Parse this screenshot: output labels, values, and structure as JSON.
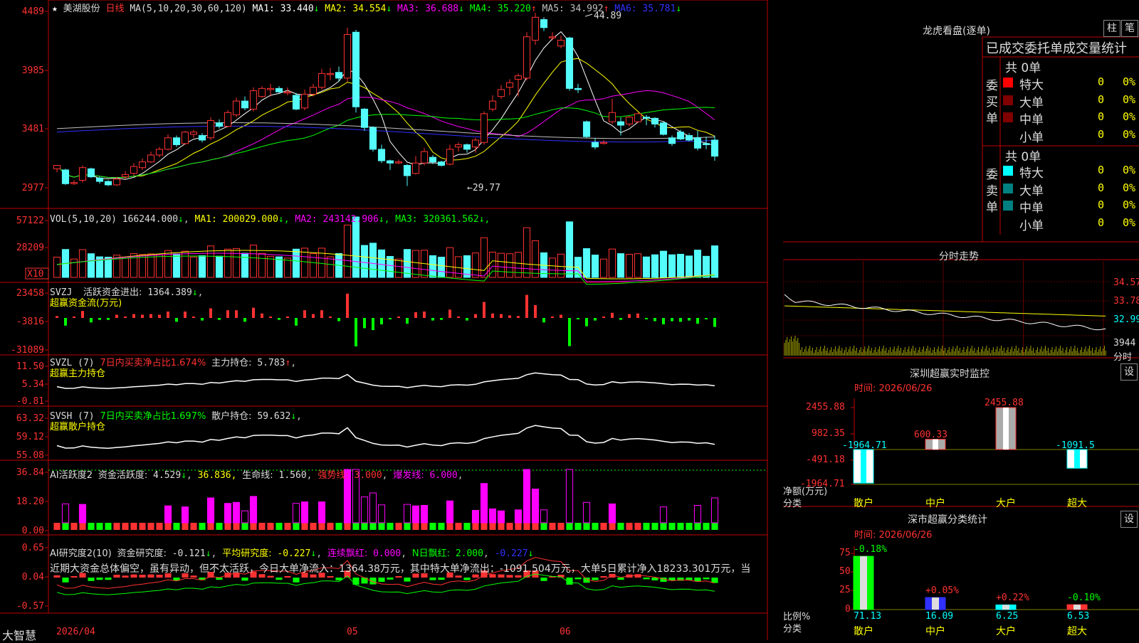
{
  "stock": {
    "name": "美湖股份",
    "period": "日线",
    "logo": "大智慧"
  },
  "colors": {
    "up": "#ff3232",
    "down": "#54fcfc",
    "cyan": "#00ffff",
    "yellow": "#ffff00",
    "magenta": "#ff00ff",
    "green": "#00ff00",
    "white": "#ffffff",
    "blue": "#3030ff",
    "grid": "#a00000",
    "axis": "#c00000"
  },
  "price_panel": {
    "ma_label": "MA(5,10,20,30,60,120)",
    "ma_items": [
      {
        "label": "MA1:",
        "value": "33.440",
        "arrow": "↓",
        "color": "#ffffff"
      },
      {
        "label": "MA2:",
        "value": "34.554",
        "arrow": "↓",
        "color": "#ffff00"
      },
      {
        "label": "MA3:",
        "value": "36.688",
        "arrow": "↓",
        "color": "#ff00ff"
      },
      {
        "label": "MA4:",
        "value": "35.220",
        "arrow": "↑",
        "color": "#00ff00"
      },
      {
        "label": "MA5:",
        "value": "34.992",
        "arrow": "↑",
        "color": "#c0c0c0"
      },
      {
        "label": "MA6:",
        "value": "35.781",
        "arrow": "↓",
        "color": "#3030ff"
      }
    ],
    "y_ticks": [
      "4489",
      "3985",
      "3481",
      "2977"
    ],
    "high_label": "44.89",
    "low_label": "29.77"
  },
  "vol_panel": {
    "title": "VOL(5,10,20)",
    "value": "166244.000",
    "arrow": "↓",
    "items": [
      {
        "label": "MA1:",
        "value": "200029.000",
        "arrow": "↓",
        "color": "#ffff00"
      },
      {
        "label": "MA2:",
        "value": "243142.906",
        "arrow": "↓",
        "color": "#ff00ff"
      },
      {
        "label": "MA3:",
        "value": "320361.562",
        "arrow": "↓",
        "color": "#00ff00"
      }
    ],
    "y_ticks": [
      "57122",
      "28209"
    ],
    "unit": "X10"
  },
  "svzj_panel": {
    "title": "SVZJ",
    "label": "活跃资金进出:",
    "value": "1364.389",
    "arrow": "↓",
    "subtitle": "超赢资金流(万元)",
    "y_ticks": [
      "23458",
      "-3816",
      "-31089"
    ]
  },
  "svzl_panel": {
    "title": "SVZL (7)",
    "pct_text": "7日内买卖净占比1.674%",
    "label": "主力持仓:",
    "value": "5.783",
    "arrow": "↑",
    "subtitle": "超赢主力持仓",
    "y_ticks": [
      "11.50",
      "5.34",
      "-0.81"
    ]
  },
  "svsh_panel": {
    "title": "SVSH (7)",
    "pct_text": "7日内买卖净占比1.697%",
    "label": "散户持仓:",
    "value": "59.632",
    "arrow": "↓",
    "subtitle": "超赢散户持仓",
    "y_ticks": [
      "63.32",
      "59.12",
      "55.08"
    ]
  },
  "ai_active": {
    "title": "AI活跃度2",
    "label": "资金活跃度:",
    "value": "4.529",
    "arrow": "↓",
    "v2": "36.836",
    "life_label": "生命线:",
    "life": "1.560",
    "strong_label": "强势线:",
    "strong": "3.000",
    "burst_label": "爆发线:",
    "burst": "6.000",
    "y_ticks": [
      "36.84",
      "18.20",
      "0.00"
    ]
  },
  "ai_research": {
    "title": "AI研究度2(10)",
    "label": "资金研究度:",
    "value": "-0.121",
    "arrow": "↓",
    "avg_label": "平均研究度:",
    "avg": "-0.227",
    "arrow2": "↓",
    "cont_label": "连续飘红:",
    "cont": "0.000",
    "n_label": "N日飘红:",
    "n": "2.000",
    "last": "-0.227",
    "arrow3": "↓",
    "commentary": "近期大资金总体偏空，虽有异动，但不太活跃，今日大单净流入：1364.38万元，其中特大单净流出：-1091.504万元，大单5日累计净入18233.301万元，当",
    "y_ticks": [
      "0.65",
      "0.04",
      "-0.57"
    ]
  },
  "x_axis": {
    "labels": [
      "2026/04",
      "05",
      "06"
    ]
  },
  "right": {
    "longhu_title": "龙虎看盘(逐单)",
    "btn1": "柱",
    "btn2": "笔",
    "stats_title": "已成交委托单成交量统计",
    "buy_label": "委买单",
    "sell_label": "委卖单",
    "buy_total": "共 0单",
    "sell_total": "共 0单",
    "buy_rows": [
      {
        "name": "特大",
        "count": "0",
        "pct": "0%",
        "color": "#ff0000"
      },
      {
        "name": "大单",
        "count": "0",
        "pct": "0%",
        "color": "#800000"
      },
      {
        "name": "中单",
        "count": "0",
        "pct": "0%",
        "color": "#800000"
      },
      {
        "name": "小单",
        "count": "0",
        "pct": "0%",
        "color": ""
      }
    ],
    "sell_rows": [
      {
        "name": "特大",
        "count": "0",
        "pct": "0%",
        "color": "#00ffff"
      },
      {
        "name": "大单",
        "count": "0",
        "pct": "0%",
        "color": "#008080"
      },
      {
        "name": "中单",
        "count": "0",
        "pct": "0%",
        "color": "#008080"
      },
      {
        "name": "小单",
        "count": "0",
        "pct": "0%",
        "color": ""
      }
    ],
    "intraday_title": "分时走势",
    "intraday_ticks": [
      "34.57",
      "33.78",
      "32.99"
    ],
    "intraday_vol": "3944",
    "intraday_vol_label": "分时",
    "monitor_title": "深圳超赢实时监控",
    "monitor_btn": "设",
    "monitor_date": "时间: 2026/06/26",
    "monitor_ticks": [
      "2455.88",
      "982.35",
      "-491.18",
      "-1964.71"
    ],
    "monitor_ylabel": "净额(万元)",
    "monitor_cat_label": "分类",
    "monitor_bars": [
      {
        "cat": "散户",
        "value": -1964.71,
        "label": "-1964.71",
        "color": "#00ffff"
      },
      {
        "cat": "中户",
        "value": 600.33,
        "label": "600.33",
        "color": "#ff3232"
      },
      {
        "cat": "大户",
        "value": 2455.88,
        "label": "2455.88",
        "color": "#ff3232"
      },
      {
        "cat": "超大",
        "value": -1091.5,
        "label": "-1091.5",
        "color": "#00ffff"
      }
    ],
    "class_title": "深市超赢分类统计",
    "class_btn": "设",
    "class_date": "时间: 2026/06/26",
    "class_ticks": [
      "75",
      "50",
      "25",
      "0"
    ],
    "class_ylabel": "比例%",
    "class_cat_label": "分类",
    "class_bars": [
      {
        "cat": "散户",
        "value": 71.13,
        "label": "71.13",
        "delta": "-0.18%",
        "color": "#00ff00",
        "cat_color": "#ffff00",
        "dcolor": "#00ff00"
      },
      {
        "cat": "中户",
        "value": 16.09,
        "label": "16.09",
        "delta": "+0.05%",
        "color": "#3030ff",
        "cat_color": "#ffff00",
        "dcolor": "#ff3232"
      },
      {
        "cat": "大户",
        "value": 6.25,
        "label": "6.25",
        "delta": "+0.22%",
        "color": "#00ffff",
        "cat_color": "#ffff00",
        "dcolor": "#ff3232"
      },
      {
        "cat": "超大",
        "value": 6.53,
        "label": "6.53",
        "delta": "-0.10%",
        "color": "#ff3232",
        "cat_color": "#ffff00",
        "dcolor": "#00ff00"
      }
    ]
  },
  "candles": [
    [
      31.3,
      31.6,
      31.0,
      31.5
    ],
    [
      31.2,
      30.0,
      29.9,
      31.3
    ],
    [
      30.1,
      30.1,
      29.9,
      30.3
    ],
    [
      30.3,
      31.4,
      30.1,
      31.6
    ],
    [
      31.3,
      30.6,
      30.5,
      31.4
    ],
    [
      30.5,
      30.2,
      30.0,
      30.6
    ],
    [
      30.2,
      29.9,
      29.8,
      30.3
    ],
    [
      29.9,
      30.4,
      29.8,
      30.6
    ],
    [
      30.6,
      30.8,
      30.4,
      31.1
    ],
    [
      30.9,
      31.5,
      30.7,
      31.8
    ],
    [
      31.4,
      31.9,
      31.2,
      32.2
    ],
    [
      31.9,
      32.5,
      31.8,
      32.8
    ],
    [
      32.5,
      33.0,
      32.3,
      33.2
    ],
    [
      33.0,
      34.0,
      32.9,
      34.3
    ],
    [
      34.0,
      33.4,
      33.2,
      34.2
    ],
    [
      33.5,
      34.5,
      33.4,
      34.6
    ],
    [
      34.3,
      34.5,
      34.0,
      34.7
    ],
    [
      34.2,
      33.8,
      33.6,
      34.4
    ],
    [
      34.0,
      35.5,
      33.8,
      35.8
    ],
    [
      35.3,
      35.0,
      34.8,
      35.6
    ],
    [
      35.0,
      36.2,
      34.9,
      36.4
    ],
    [
      36.0,
      37.2,
      35.8,
      37.5
    ],
    [
      37.2,
      36.6,
      36.4,
      37.6
    ],
    [
      36.5,
      38.1,
      36.3,
      38.4
    ],
    [
      37.6,
      38.3,
      37.5,
      38.5
    ],
    [
      38.2,
      38.3,
      37.6,
      38.7
    ],
    [
      38.3,
      38.0,
      37.9,
      38.5
    ],
    [
      38.0,
      38.0,
      37.7,
      38.4
    ],
    [
      37.7,
      36.5,
      36.4,
      37.9
    ],
    [
      36.6,
      37.8,
      36.4,
      38.2
    ],
    [
      37.8,
      38.4,
      37.6,
      38.7
    ],
    [
      38.4,
      39.6,
      38.2,
      40.0
    ],
    [
      39.6,
      39.6,
      39.0,
      40.1
    ],
    [
      39.7,
      39.2,
      38.9,
      40.2
    ],
    [
      39.2,
      43.0,
      38.9,
      43.6
    ],
    [
      43.2,
      36.7,
      36.2,
      43.4
    ],
    [
      36.5,
      34.9,
      34.6,
      36.6
    ],
    [
      34.9,
      33.0,
      32.8,
      35.0
    ],
    [
      33.0,
      32.0,
      31.8,
      33.4
    ],
    [
      32.0,
      31.8,
      31.2,
      32.1
    ],
    [
      31.9,
      31.9,
      31.7,
      32.1
    ],
    [
      31.6,
      30.7,
      29.8,
      31.7
    ],
    [
      30.9,
      31.8,
      30.8,
      32.4
    ],
    [
      31.8,
      32.8,
      31.6,
      33.1
    ],
    [
      32.3,
      31.9,
      31.7,
      32.5
    ],
    [
      31.9,
      31.6,
      31.5,
      32.0
    ],
    [
      31.7,
      33.0,
      31.6,
      33.4
    ],
    [
      33.2,
      33.4,
      32.8,
      33.6
    ],
    [
      33.4,
      33.0,
      32.7,
      33.5
    ],
    [
      33.2,
      33.8,
      32.7,
      34.0
    ],
    [
      33.6,
      36.1,
      33.4,
      36.3
    ],
    [
      36.5,
      37.2,
      36.3,
      37.7
    ],
    [
      37.6,
      38.2,
      37.4,
      38.6
    ],
    [
      38.4,
      38.8,
      37.7,
      39.1
    ],
    [
      39.1,
      39.4,
      37.6,
      39.6
    ],
    [
      39.2,
      42.8,
      39.0,
      43.2
    ],
    [
      42.5,
      44.5,
      42.1,
      44.89
    ],
    [
      44.3,
      43.6,
      43.3,
      44.5
    ],
    [
      42.8,
      42.8,
      42.5,
      43.2
    ],
    [
      42.0,
      42.5,
      41.8,
      42.9
    ],
    [
      42.7,
      38.3,
      38.1,
      42.8
    ],
    [
      38.3,
      38.2,
      37.9,
      38.7
    ],
    [
      35.4,
      34.1,
      34.0,
      35.5
    ],
    [
      33.6,
      33.2,
      33.0,
      34.0
    ],
    [
      33.6,
      33.6,
      33.4,
      33.8
    ],
    [
      35.4,
      36.2,
      35.2,
      37.4
    ],
    [
      35.4,
      35.1,
      34.2,
      35.8
    ],
    [
      35.2,
      35.8,
      35.0,
      35.9
    ],
    [
      35.4,
      36.1,
      35.3,
      36.2
    ],
    [
      35.8,
      35.7,
      35.1,
      36.0
    ],
    [
      35.7,
      35.2,
      34.9,
      35.8
    ],
    [
      35.3,
      34.3,
      34.2,
      35.4
    ],
    [
      34.0,
      33.5,
      33.3,
      34.2
    ],
    [
      34.5,
      33.9,
      33.8,
      34.7
    ],
    [
      34.2,
      33.8,
      33.7,
      34.4
    ],
    [
      34.0,
      33.1,
      32.9,
      34.6
    ],
    [
      33.5,
      33.4,
      33.0,
      34.1
    ],
    [
      33.8,
      32.4,
      32.0,
      34.2
    ]
  ]
}
